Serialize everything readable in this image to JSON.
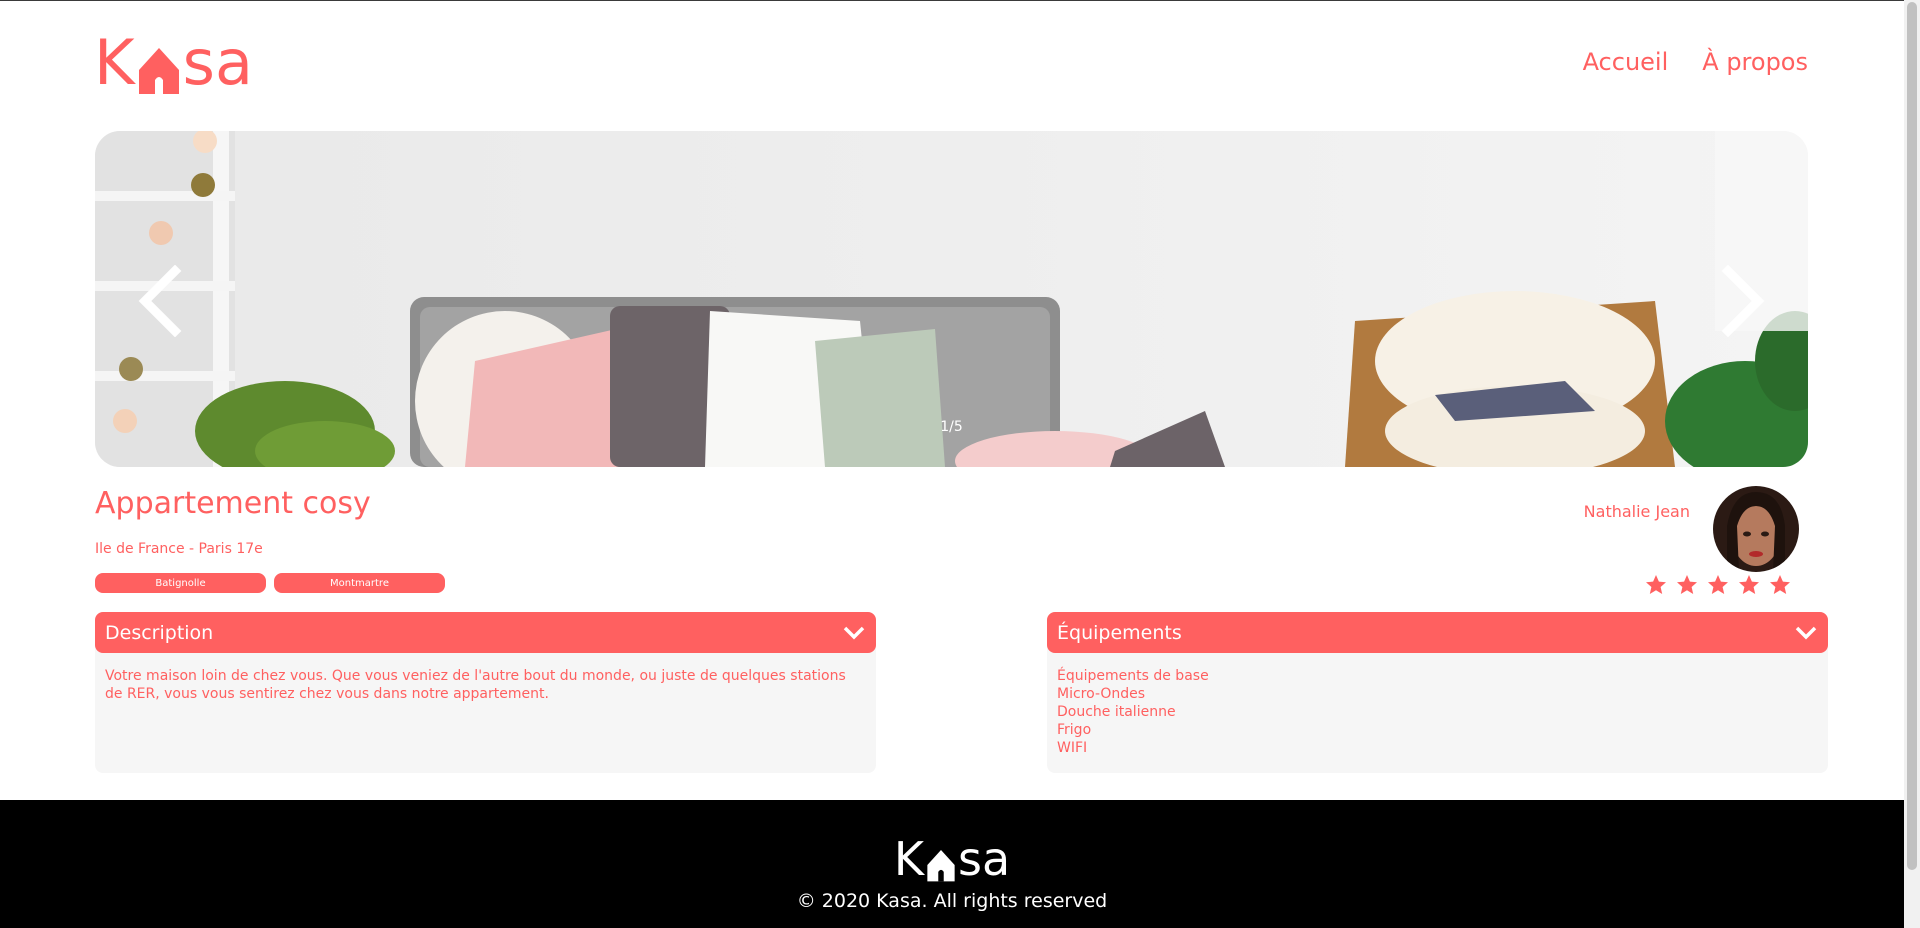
{
  "header": {
    "logo": {
      "text_before": "K",
      "text_after": "sa"
    },
    "nav": [
      {
        "label": "Accueil"
      },
      {
        "label": "À propos"
      }
    ]
  },
  "carousel": {
    "counter": "1/5",
    "prev_icon": "chevron-left-icon",
    "next_icon": "chevron-right-icon"
  },
  "listing": {
    "title": "Appartement cosy",
    "location": "Ile de France - Paris 17e",
    "tags": [
      "Batignolle",
      "Montmartre"
    ],
    "host": {
      "name": "Nathalie Jean"
    },
    "rating": {
      "value": 5,
      "max": 5
    }
  },
  "collapses": {
    "description": {
      "title": "Description",
      "content": "Votre maison loin de chez vous. Que vous veniez de l'autre bout du monde, ou juste de quelques stations de RER, vous vous sentirez chez vous dans notre appartement."
    },
    "equipments": {
      "title": "Équipements",
      "items": [
        "Équipements de base",
        "Micro-Ondes",
        "Douche italienne",
        "Frigo",
        "WIFI"
      ]
    }
  },
  "footer": {
    "logo": {
      "text_before": "K",
      "text_after": "sa"
    },
    "copyright": "© 2020 Kasa. All rights reserved"
  },
  "colors": {
    "primary": "#FF6060",
    "panel": "#F6F6F6",
    "footer": "#000000"
  }
}
